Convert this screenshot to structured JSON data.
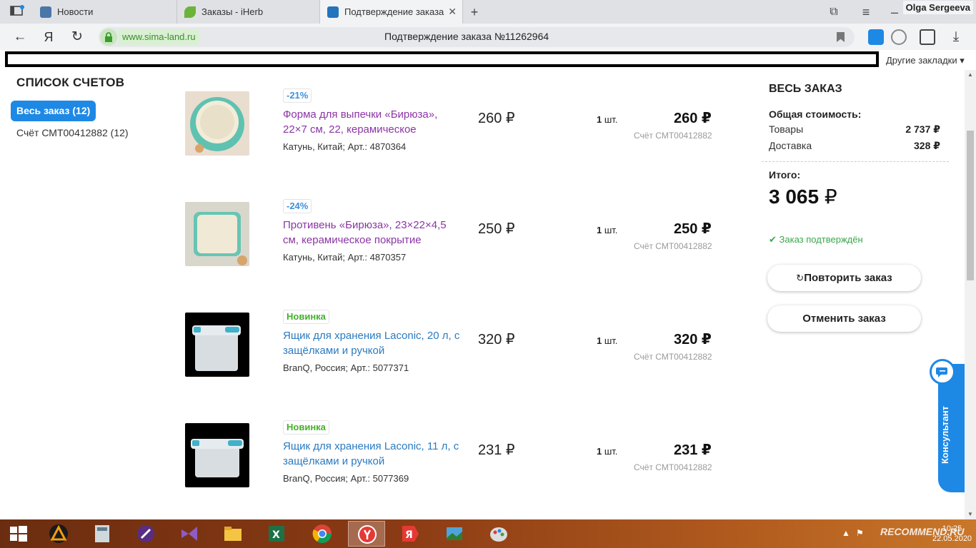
{
  "browser": {
    "tabs": [
      {
        "title": "Новости"
      },
      {
        "title": "Заказы - iHerb"
      },
      {
        "title": "Подтверждение заказа"
      }
    ],
    "user": "Olga Sergeeva",
    "url": "www.sima-land.ru",
    "page_title": "Подтверждение заказа №11262964",
    "other_bookmarks": "Другие закладки"
  },
  "sidebar": {
    "title": "СПИСОК СЧЕТОВ",
    "all_orders": "Весь заказ (12)",
    "invoice": "Счёт СМТ00412882 (12)"
  },
  "products": [
    {
      "badge": "-21%",
      "badge_type": "discount",
      "name": "Форма для выпечки «Бирюза», 22×7 см, 22, керамическое",
      "meta": "Катунь, Китай; Арт.: 4870364",
      "unit_price": "260 ₽",
      "qty": "1",
      "qty_unit": "шт.",
      "total": "260 ₽",
      "invoice": "Счёт СМТ00412882"
    },
    {
      "badge": "-24%",
      "badge_type": "discount",
      "name": "Противень «Бирюза», 23×22×4,5 см, керамическое покрытие",
      "meta": "Катунь, Китай; Арт.: 4870357",
      "unit_price": "250 ₽",
      "qty": "1",
      "qty_unit": "шт.",
      "total": "250 ₽",
      "invoice": "Счёт СМТ00412882"
    },
    {
      "badge": "Новинка",
      "badge_type": "new",
      "name": "Ящик для хранения Laconic, 20 л, с защёлками и ручкой",
      "meta": "BranQ, Россия; Арт.: 5077371",
      "unit_price": "320 ₽",
      "qty": "1",
      "qty_unit": "шт.",
      "total": "320 ₽",
      "invoice": "Счёт СМТ00412882"
    },
    {
      "badge": "Новинка",
      "badge_type": "new",
      "name": "Ящик для хранения Laconic, 11 л, с защёлками и ручкой",
      "meta": "BranQ, Россия; Арт.: 5077369",
      "unit_price": "231 ₽",
      "qty": "1",
      "qty_unit": "шт.",
      "total": "231 ₽",
      "invoice": "Счёт СМТ00412882"
    }
  ],
  "summary": {
    "title": "ВЕСЬ ЗАКАЗ",
    "subtitle": "Общая стоимость:",
    "goods_label": "Товары",
    "goods_value": "2 737 ₽",
    "delivery_label": "Доставка",
    "delivery_value": "328 ₽",
    "total_label": "Итого:",
    "total_value": "3 065",
    "currency": "₽",
    "status": "Заказ подтверждён",
    "repeat_button": "Повторить заказ",
    "cancel_button": "Отменить заказ"
  },
  "consultant": "Консультант",
  "taskbar": {
    "time": "10:25",
    "date": "22.05.2020",
    "watermark": "RECOMMEND.RU"
  },
  "colors": {
    "accent": "#1e88e5",
    "link_purple": "#8b35a5",
    "link_blue": "#2b7bc0",
    "success": "#3aa84a",
    "new_badge": "#43b02a"
  }
}
